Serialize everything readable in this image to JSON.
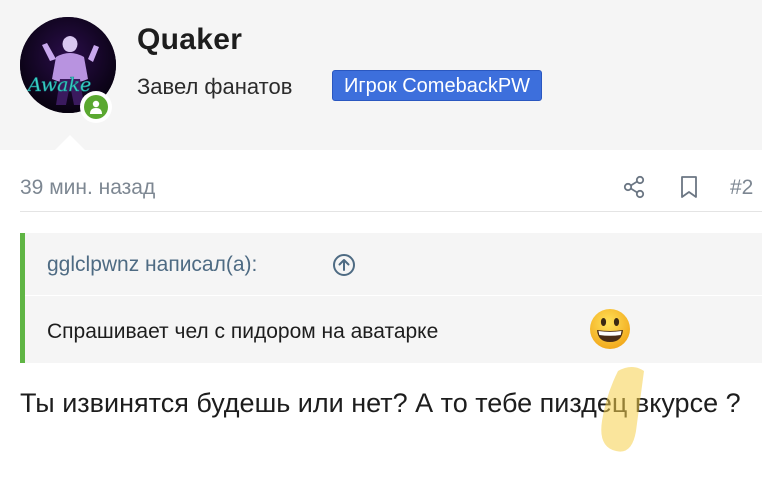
{
  "user": {
    "name": "Quaker",
    "title": "Завел фанатов",
    "banner": "Игрок ComebackPW",
    "avatar_text": "Awake",
    "online": true
  },
  "post": {
    "time": "39 мин. назад",
    "number": "#2",
    "actions": [
      "share-icon",
      "bookmark-icon"
    ]
  },
  "quote": {
    "author_line": "gglclpwnz написал(а):",
    "text": "Спрашивает чел с пидором на аватарке",
    "emoji": "grinning-face"
  },
  "message": {
    "text": "Ты извинятся будешь или нет? А то тебе пиздец вкурсе ?"
  },
  "colors": {
    "accent_green": "#5fb544",
    "banner_blue": "#3d6fdc",
    "online_green": "#5aa830",
    "muted_text": "#7d8792",
    "quote_author": "#4e6b83"
  }
}
